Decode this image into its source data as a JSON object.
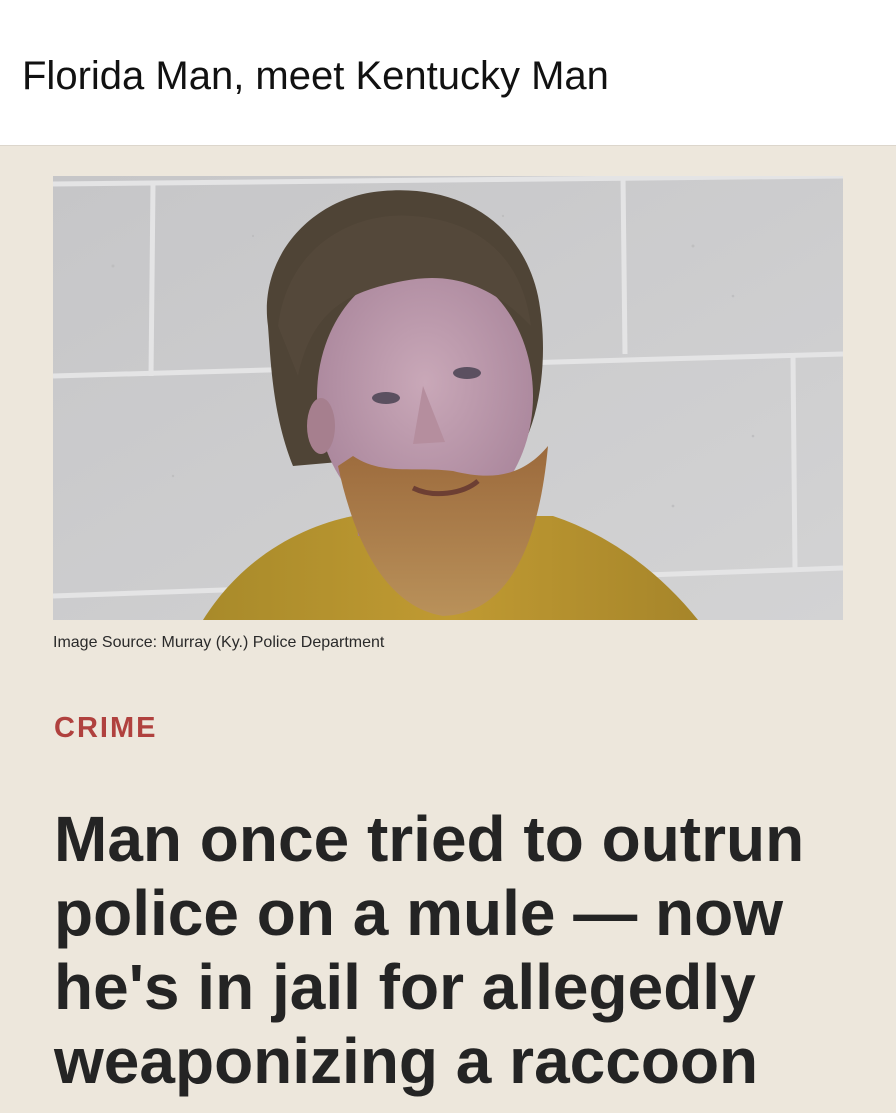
{
  "post": {
    "title": "Florida Man, meet Kentucky Man"
  },
  "article": {
    "image_alt": "Booking photo of a bearded man in a yellow shirt against a cinder block wall",
    "image_caption": "Image Source: Murray (Ky.) Police Department",
    "category": "CRIME",
    "headline": "Man once tried to outrun police on a mule — now he's in jail for allegedly weaponizing a raccoon"
  },
  "colors": {
    "page_background": "#ede7dc",
    "header_background": "#ffffff",
    "category_red": "#b0413e",
    "headline_text": "#242424"
  }
}
